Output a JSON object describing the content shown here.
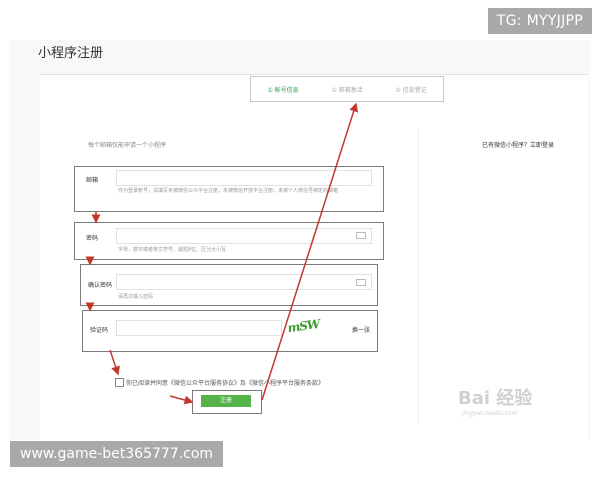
{
  "overlay": {
    "tg_badge": "TG: MYYJJPP",
    "site_badge": "www.game-bet365777.com"
  },
  "page": {
    "title": "小程序注册"
  },
  "steps": [
    {
      "label": "① 帐号信息",
      "active": true
    },
    {
      "label": "② 邮箱激活",
      "active": false
    },
    {
      "label": "③ 信息登记",
      "active": false
    }
  ],
  "form": {
    "hint": "每个邮箱仅能申请一个小程序",
    "login_prompt": "已有微信小程序？立即登录",
    "email": {
      "label": "邮箱",
      "help": "作为登录帐号，请填写未被微信公众平台注册，未被微信开放平台注册，未被个人微信号绑定的邮箱"
    },
    "password": {
      "label": "密码",
      "help": "字母、数字或者英文符号，最短8位，区分大小写"
    },
    "confirm_password": {
      "label": "确认密码",
      "help": "请再次输入密码"
    },
    "captcha": {
      "label": "验证码",
      "image_text": "mSW",
      "refresh": "换一张"
    },
    "agreement": {
      "text": "你已阅读并同意《微信公众平台服务协议》及《微信小程序平台服务条款》"
    },
    "submit": "注册"
  },
  "watermark": {
    "logo": "Bai 经验",
    "sub": "jingyan.baidu.com"
  },
  "colors": {
    "accent": "#55b34a",
    "annotation": "#c0392b"
  }
}
